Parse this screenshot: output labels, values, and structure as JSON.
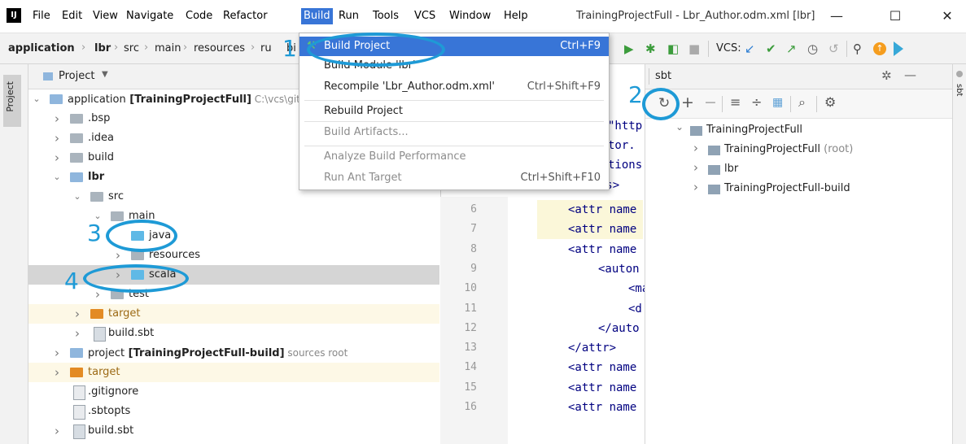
{
  "menubar": {
    "items": [
      "File",
      "Edit",
      "View",
      "Navigate",
      "Code",
      "Refactor",
      "Build",
      "Run",
      "Tools",
      "VCS",
      "Window",
      "Help"
    ],
    "window_title": "TrainingProjectFull - Lbr_Author.odm.xml [lbr]"
  },
  "breadcrumb": [
    "application",
    "lbr",
    "src",
    "main",
    "resources",
    "ru",
    "bi"
  ],
  "toolbar": {
    "vcs_label": "VCS:"
  },
  "build_menu": {
    "items": [
      {
        "label": "Build Project",
        "shortcut": "Ctrl+F9",
        "state": "selected"
      },
      {
        "label": "Build Module 'lbr'",
        "shortcut": "",
        "state": "normal"
      },
      {
        "label": "Recompile 'Lbr_Author.odm.xml'",
        "shortcut": "Ctrl+Shift+F9",
        "state": "normal"
      },
      {
        "label": "Rebuild Project",
        "shortcut": "",
        "state": "normal"
      },
      {
        "label": "Build Artifacts...",
        "shortcut": "",
        "state": "disabled"
      },
      {
        "label": "Analyze Build Performance",
        "shortcut": "",
        "state": "disabled"
      },
      {
        "label": "Run Ant Target",
        "shortcut": "Ctrl+Shift+F10",
        "state": "disabled"
      }
    ]
  },
  "project_panel": {
    "title": "Project",
    "stripe_label": "Project",
    "tree": [
      {
        "label": "application",
        "bold_suffix": "[TrainingProjectFull]",
        "hint": "C:\\vcs\\git\\",
        "depth": 0,
        "arrow": "open",
        "icon": "blue"
      },
      {
        "label": ".bsp",
        "depth": 1,
        "arrow": "closed",
        "icon": "gray"
      },
      {
        "label": ".idea",
        "depth": 1,
        "arrow": "closed",
        "icon": "gray"
      },
      {
        "label": "build",
        "depth": 1,
        "arrow": "closed",
        "icon": "gray"
      },
      {
        "label": "lbr",
        "depth": 1,
        "arrow": "open",
        "icon": "blue",
        "bold": true
      },
      {
        "label": "src",
        "depth": 2,
        "arrow": "open",
        "icon": "gray"
      },
      {
        "label": "main",
        "depth": 3,
        "arrow": "open",
        "icon": "gray"
      },
      {
        "label": "java",
        "depth": 4,
        "arrow": "",
        "icon": "cyan"
      },
      {
        "label": "resources",
        "depth": 4,
        "arrow": "closed",
        "icon": "gray"
      },
      {
        "label": "scala",
        "depth": 4,
        "arrow": "closed",
        "icon": "cyan",
        "selected": true
      },
      {
        "label": "test",
        "depth": 3,
        "arrow": "closed",
        "icon": "gray"
      },
      {
        "label": "target",
        "depth": 2,
        "arrow": "closed",
        "icon": "orange",
        "excluded": true
      },
      {
        "label": "build.sbt",
        "depth": 2,
        "arrow": "closed",
        "icon": "sbt"
      },
      {
        "label": "project",
        "bold_suffix": "[TrainingProjectFull-build]",
        "hint": "sources root",
        "depth": 1,
        "arrow": "closed",
        "icon": "blue"
      },
      {
        "label": "target",
        "depth": 1,
        "arrow": "closed",
        "icon": "orange",
        "excluded": true
      },
      {
        "label": ".gitignore",
        "depth": 1,
        "arrow": "",
        "icon": "file"
      },
      {
        "label": ".sbtopts",
        "depth": 1,
        "arrow": "",
        "icon": "file"
      },
      {
        "label": "build.sbt",
        "depth": 1,
        "arrow": "closed",
        "icon": "sbt"
      }
    ]
  },
  "editor": {
    "top_fragments": [
      "\"http",
      "tor.",
      "tions"
    ],
    "attributes_fragment": "<attributes>",
    "lines": [
      {
        "num": "6",
        "text": "<attr name"
      },
      {
        "num": "7",
        "text": "<attr name"
      },
      {
        "num": "8",
        "text": "<attr name"
      },
      {
        "num": "9",
        "text": "<auton"
      },
      {
        "num": "10",
        "text": "<ma"
      },
      {
        "num": "11",
        "text": "<d"
      },
      {
        "num": "12",
        "text": "</auto"
      },
      {
        "num": "13",
        "text": "</attr>"
      },
      {
        "num": "14",
        "text": "<attr name"
      },
      {
        "num": "15",
        "text": "<attr name"
      },
      {
        "num": "16",
        "text": "<attr name"
      }
    ]
  },
  "sbt_panel": {
    "title": "sbt",
    "right_stripe_label": "sbt",
    "tree": [
      {
        "label": "TrainingProjectFull",
        "depth": 0,
        "arrow": "open"
      },
      {
        "label": "TrainingProjectFull",
        "suffix": "(root)",
        "depth": 1,
        "arrow": "closed"
      },
      {
        "label": "lbr",
        "depth": 1,
        "arrow": "closed"
      },
      {
        "label": "TrainingProjectFull-build",
        "depth": 1,
        "arrow": "closed"
      }
    ]
  },
  "annotations": [
    "1",
    "2",
    "3",
    "4"
  ]
}
